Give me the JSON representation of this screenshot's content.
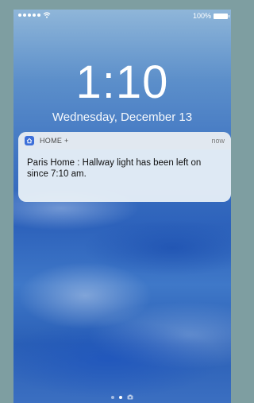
{
  "status_bar": {
    "battery_text": "100%",
    "signal_dots": 5
  },
  "lock_screen": {
    "time": "1:10",
    "date": "Wednesday, December 13"
  },
  "notification": {
    "app_name": "HOME +",
    "time": "now",
    "message": "Paris Home : Hallway light has been left on since 7:10 am.",
    "icon": "home-app-icon",
    "icon_color": "#3d6fd9"
  },
  "page_indicator": {
    "pages": 3,
    "current": 2,
    "last_icon": "camera-icon"
  }
}
